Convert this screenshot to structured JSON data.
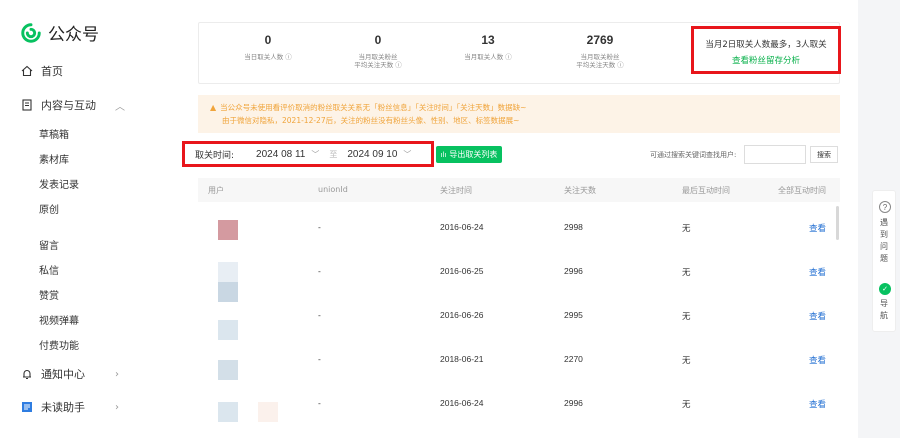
{
  "brand": {
    "name": "公众号"
  },
  "nav": {
    "home": "首页",
    "content": "内容与互动",
    "sub": [
      "草稿箱",
      "素材库",
      "发表记录",
      "原创",
      "留言",
      "私信",
      "赞赏",
      "视频弹幕",
      "付费功能"
    ],
    "notifications": "通知中心",
    "unread": "未读助手"
  },
  "stats": [
    {
      "value": "0",
      "label1": "当日取关人数",
      "label2": ""
    },
    {
      "value": "0",
      "label1": "当月取关粉丝",
      "label2": "平均关注天数"
    },
    {
      "value": "13",
      "label1": "当月取关人数",
      "label2": ""
    },
    {
      "value": "2769",
      "label1": "当月取关粉丝",
      "label2": "平均关注天数"
    }
  ],
  "highlight": {
    "text": "当月2日取关人数最多，3人取关",
    "link": "查看粉丝留存分析"
  },
  "notice": {
    "line1": "当公众号未使用看评价取消的粉丝取关关系无「粉丝信息」「关注时间」「关注天数」数据缺~",
    "line2": "由于微信对隐私，2021-12-27后，关注的粉丝没有粉丝头像、性别、地区、标签数据展~"
  },
  "filter": {
    "label": "取关时间:",
    "start": "2024 08 11",
    "separator": "至",
    "end": "2024 09 10"
  },
  "export_label": "导出取关列表",
  "search": {
    "label": "可通过搜索关键词查找用户:",
    "placeholder": "",
    "button": "搜索"
  },
  "table": {
    "headers": [
      "用户",
      "unionId",
      "关注时间",
      "关注天数",
      "最后互动时间",
      "全部互动时间"
    ],
    "rows": [
      {
        "unionid": "-",
        "follow_date": "2016-06-24",
        "days": "2998",
        "last": "无",
        "action": "查看"
      },
      {
        "unionid": "-",
        "follow_date": "2016-06-25",
        "days": "2996",
        "last": "无",
        "action": "查看"
      },
      {
        "unionid": "-",
        "follow_date": "2016-06-26",
        "days": "2995",
        "last": "无",
        "action": "查看"
      },
      {
        "unionid": "-",
        "follow_date": "2018-06-21",
        "days": "2270",
        "last": "无",
        "action": "查看"
      },
      {
        "unionid": "-",
        "follow_date": "2016-06-24",
        "days": "2996",
        "last": "无",
        "action": "查看"
      }
    ]
  },
  "float_panel": {
    "help": "遇到问题",
    "guide": "导航"
  },
  "colors": {
    "accent_green": "#07c160",
    "link_blue": "#1e6cd2",
    "highlight_red": "#e8161b",
    "notice_orange": "#f0a43b"
  }
}
